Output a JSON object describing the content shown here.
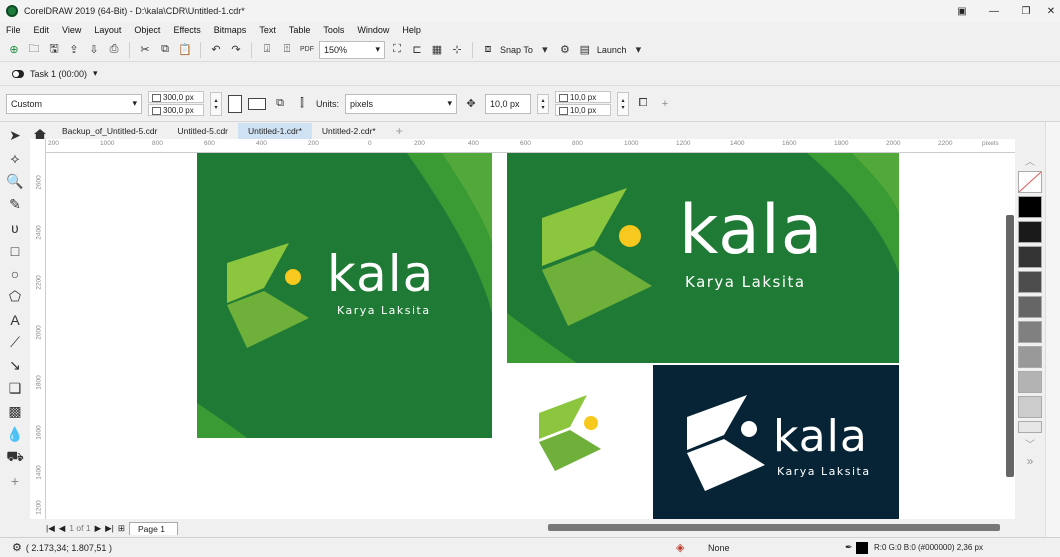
{
  "window": {
    "title": "CorelDRAW 2019 (64-Bit) - D:\\kala\\CDR\\Untitled-1.cdr*"
  },
  "menu": [
    "File",
    "Edit",
    "View",
    "Layout",
    "Object",
    "Effects",
    "Bitmaps",
    "Text",
    "Table",
    "Tools",
    "Window",
    "Help"
  ],
  "toolbar": {
    "zoom": "150%",
    "snap_to": "Snap To",
    "launch": "Launch"
  },
  "task": {
    "label": "Task 1 (00:00)"
  },
  "property_bar": {
    "preset": "Custom",
    "width": "300,0 px",
    "height": "300,0 px",
    "units_label": "Units:",
    "units": "pixels",
    "nudge": "10,0 px",
    "duplicate_x": "10,0 px",
    "duplicate_y": "10,0 px"
  },
  "document_tabs": [
    "Backup_of_Untitled-5.cdr",
    "Untitled-5.cdr",
    "Untitled-1.cdr*",
    "Untitled-2.cdr*"
  ],
  "active_tab": "Untitled-1.cdr*",
  "ruler": {
    "h_ticks": [
      "200",
      "1000",
      "800",
      "600",
      "400",
      "200",
      "0",
      "200",
      "400",
      "600",
      "800",
      "1000",
      "1200",
      "1400",
      "1600",
      "1800",
      "2000",
      "2200"
    ],
    "unit": "pixels",
    "v_ticks": [
      "2600",
      "2400",
      "2200",
      "2000",
      "1800",
      "1600",
      "1400",
      "1200"
    ]
  },
  "artwork": {
    "brand": "kala",
    "tagline": "Karya Laksita",
    "colors": {
      "green_dark": "#1f7a35",
      "green_mid": "#3a9a33",
      "green_light": "#8cc63f",
      "yellow": "#f7c81e",
      "navy": "#062435",
      "white": "#ffffff"
    }
  },
  "palette": [
    "#ffffff",
    "#000000",
    "#1a1a1a",
    "#333333",
    "#4d4d4d",
    "#666666",
    "#808080",
    "#999999",
    "#b3b3b3",
    "#cccccc",
    "#e6e6e6"
  ],
  "page_nav": {
    "position": "1 of 1",
    "page": "Page 1"
  },
  "status": {
    "coords": "( 2.173,34; 1.807,51 )",
    "fill": "None",
    "outline": "R:0 G:0 B:0 (#000000)  2,36 px"
  }
}
